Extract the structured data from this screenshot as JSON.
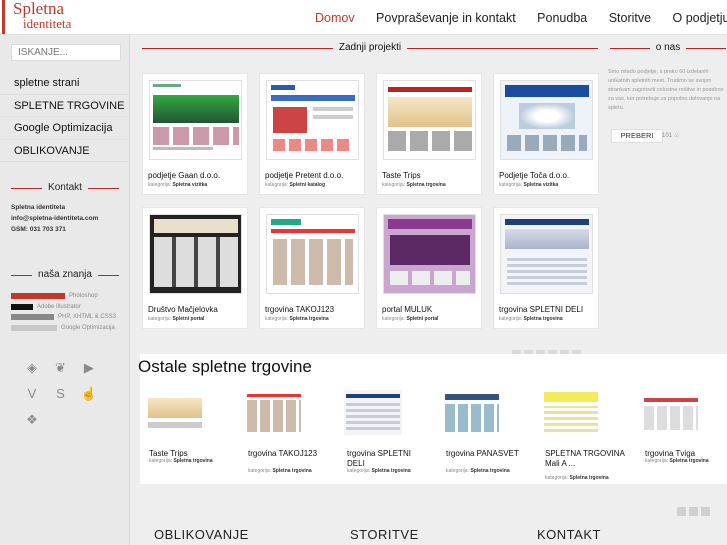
{
  "header": {
    "logo_line1": "Spletna",
    "logo_line2": "identiteta",
    "nav": [
      "Domov",
      "Povpraševanje in kontakt",
      "Ponudba",
      "Storitve",
      "O podjetju"
    ]
  },
  "sidebar": {
    "search_placeholder": "ISKANJE...",
    "menu": [
      "spletne strani",
      "SPLETNE TRGOVINE",
      "Google Optimizacija",
      "OBLIKOVANJE"
    ],
    "contact_title": "Kontakt",
    "contact_lines": [
      "Spletna identiteta",
      "info@spletna-identiteta.com",
      "GSM: 031 703 371"
    ],
    "skills_title": "naša znanja",
    "skills": [
      {
        "label": "Photoshop",
        "level": 0.5,
        "color": "#c0392b"
      },
      {
        "label": "Adobe Illustrator",
        "level": 0.2,
        "color": "#111111"
      },
      {
        "label": "PHP, XHTML & CSS3",
        "level": 0.4,
        "color": "#888888"
      },
      {
        "label": "Google Optimizacija",
        "level": 0.43,
        "color": "#c8c8c8"
      }
    ],
    "social_icons": [
      "digg-icon",
      "squirrel-icon",
      "youtube-icon",
      "vimeo-icon",
      "skype-icon",
      "thumbs-up-icon",
      "dropbox-icon"
    ]
  },
  "main": {
    "projects_title": "Zadnji projekti",
    "about_title": "o nas",
    "about_text": "Smo mlado podjetje, s preko 60 izdelanih unikatnih spletnih mest. Trudimo se svojim strankam zagotoviti celostne rešitve in posebno za vas, ker potrebuje za popolno delovanje na spletu.",
    "read_more": "PREBERI",
    "likes": "101",
    "category_prefix": "kategorija:",
    "projects": [
      {
        "title": "podjetje Gaan d.o.o.",
        "category": "Spletna vizitka"
      },
      {
        "title": "podjetje Pretent d.o.o.",
        "category": "Spletni katalog"
      },
      {
        "title": "Taste Trips",
        "category": "Spletna trgovina"
      },
      {
        "title": "Podjetje Toča d.o.o.",
        "category": "Spletna vizitka"
      },
      {
        "title": "Društvo Mačjelovka",
        "category": "Spletni portal"
      },
      {
        "title": "trgovina TAKOJ123",
        "category": "Spletna trgovina"
      },
      {
        "title": "portal MULUK",
        "category": "Spletni portal"
      },
      {
        "title": "trgovina SPLETNI DELI",
        "category": "Spletna trgovina"
      }
    ],
    "other_title": "Ostale spletne trgovine",
    "others": [
      {
        "title": "Taste Trips",
        "category": "Spletna trgovina"
      },
      {
        "title": "trgovina TAKOJ123",
        "category": "Spletna trgovina"
      },
      {
        "title": "trgovina SPLETNI DELI",
        "category": "Spletna trgovina"
      },
      {
        "title": "trgovina PANASVET",
        "category": "Spletna trgovina"
      },
      {
        "title": "SPLETNA TRGOVINA Mali A ...",
        "category": "Spletna trgovina"
      },
      {
        "title": "trgovina Tviga",
        "category": "Spletna trgovina"
      }
    ],
    "footer": [
      "OBLIKOVANJE",
      "STORITVE",
      "KONTAKT"
    ]
  }
}
